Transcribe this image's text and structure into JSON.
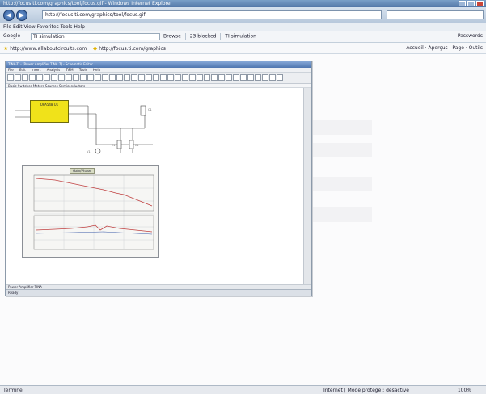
{
  "browser": {
    "title": "http://focus.ti.com/graphics/tool/focus.gif - Windows Internet Explorer",
    "url": "http://focus.ti.com/graphics/tool/focus.gif",
    "menu": "File  Edit  View  Favorites  Tools  Help",
    "google_label": "Google",
    "search_value": "TI simulation",
    "toolbar_items": [
      "Browse",
      "23 blocked",
      "TI",
      "simulation"
    ],
    "passwords_label": "Passwords",
    "fav_url": "http://www.allaboutcircuits.com",
    "fav_link": "http://focus.ti.com/graphics",
    "fav_tools": [
      "Accueil",
      "Aperçus",
      "Page",
      "Outils"
    ],
    "status_left": "Terminé",
    "status_zone": "Internet | Mode protégé : désactivé",
    "status_zoom": "100%"
  },
  "inner_app": {
    "title": "TINA-TI - [Power Amplifier TINA 7] - Schematic Editor",
    "menu": [
      "File",
      "Edit",
      "Insert",
      "Analysis",
      "T&M",
      "Tools",
      "Help"
    ],
    "tab": "Basic  Switches  Meters  Sources  Semiconductors",
    "chip_label": "OPA548 U1",
    "plot_title": "Gain/Phase",
    "tab_bottom": "Power Amplifier TINA",
    "status": "Ready"
  },
  "colors": {
    "titlebar": "#5478a8",
    "chip": "#f0e21a",
    "trace_red": "#c04040",
    "trace_blue": "#3a5aa8"
  }
}
